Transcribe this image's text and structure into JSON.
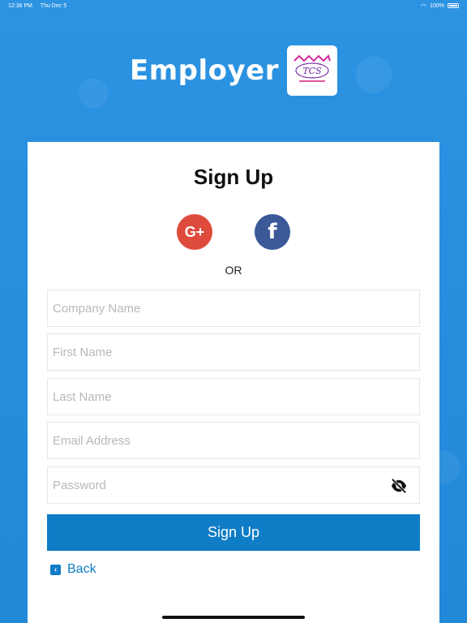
{
  "status_bar": {
    "time": "12:36 PM",
    "date": "Thu Dec 5",
    "battery": "100%"
  },
  "header": {
    "brand": "Employer",
    "logo_text": "TCS"
  },
  "form": {
    "title": "Sign Up",
    "or_label": "OR",
    "social": {
      "google_label": "G+",
      "facebook_label": "f"
    },
    "fields": {
      "company_placeholder": "Company Name",
      "first_name_placeholder": "First Name",
      "last_name_placeholder": "Last Name",
      "email_placeholder": "Email Address",
      "password_placeholder": "Password"
    },
    "signup_label": "Sign Up",
    "back_label": "Back"
  },
  "colors": {
    "background": "#2a8fde",
    "primary": "#0f7cc6",
    "google": "#de4b3d",
    "facebook": "#3b5998"
  },
  "icons": {
    "password_toggle": "eye-off-icon",
    "back": "chevron-left-icon",
    "wifi": "wifi-icon",
    "battery": "battery-icon"
  }
}
